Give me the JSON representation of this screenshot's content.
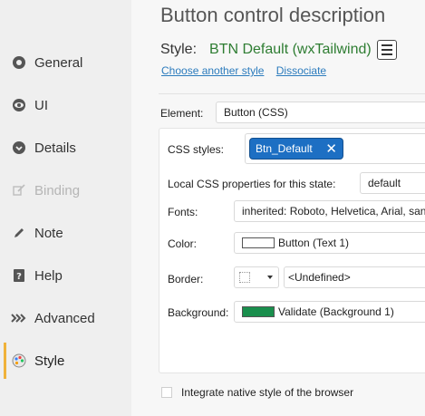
{
  "sidebar": {
    "items": [
      {
        "label": "General",
        "icon": "gear-icon",
        "disabled": false,
        "active": false
      },
      {
        "label": "UI",
        "icon": "eye-icon",
        "disabled": false,
        "active": false
      },
      {
        "label": "Details",
        "icon": "details-icon",
        "disabled": false,
        "active": false
      },
      {
        "label": "Binding",
        "icon": "binding-icon",
        "disabled": true,
        "active": false
      },
      {
        "label": "Note",
        "icon": "pencil-icon",
        "disabled": false,
        "active": false
      },
      {
        "label": "Help",
        "icon": "help-icon",
        "disabled": false,
        "active": false
      },
      {
        "label": "Advanced",
        "icon": "advanced-icon",
        "disabled": false,
        "active": false
      },
      {
        "label": "Style",
        "icon": "palette-icon",
        "disabled": false,
        "active": true
      }
    ],
    "accent_color": "#f0b23a"
  },
  "header": {
    "title": "Button control description",
    "style_label": "Style:",
    "style_value": "BTN Default (wxTailwind)",
    "link_choose": "Choose another style",
    "link_dissociate": "Dissociate"
  },
  "form": {
    "element_label": "Element:",
    "element_value": "Button (CSS)",
    "css_styles_label": "CSS styles:",
    "css_tag": "Btn_Default",
    "local_css_label": "Local CSS properties for this state:",
    "local_css_value": "default",
    "fonts_label": "Fonts:",
    "fonts_value": "inherited: Roboto, Helvetica, Arial, sans",
    "color_label": "Color:",
    "color_value": "Button (Text 1)",
    "color_swatch": "#ffffff",
    "border_label": "Border:",
    "border_value": "<Undefined>",
    "background_label": "Background:",
    "background_value": "Validate (Background 1)",
    "background_swatch": "#1a8f4d"
  },
  "footer": {
    "checkbox_label": "Integrate native style of the browser"
  }
}
